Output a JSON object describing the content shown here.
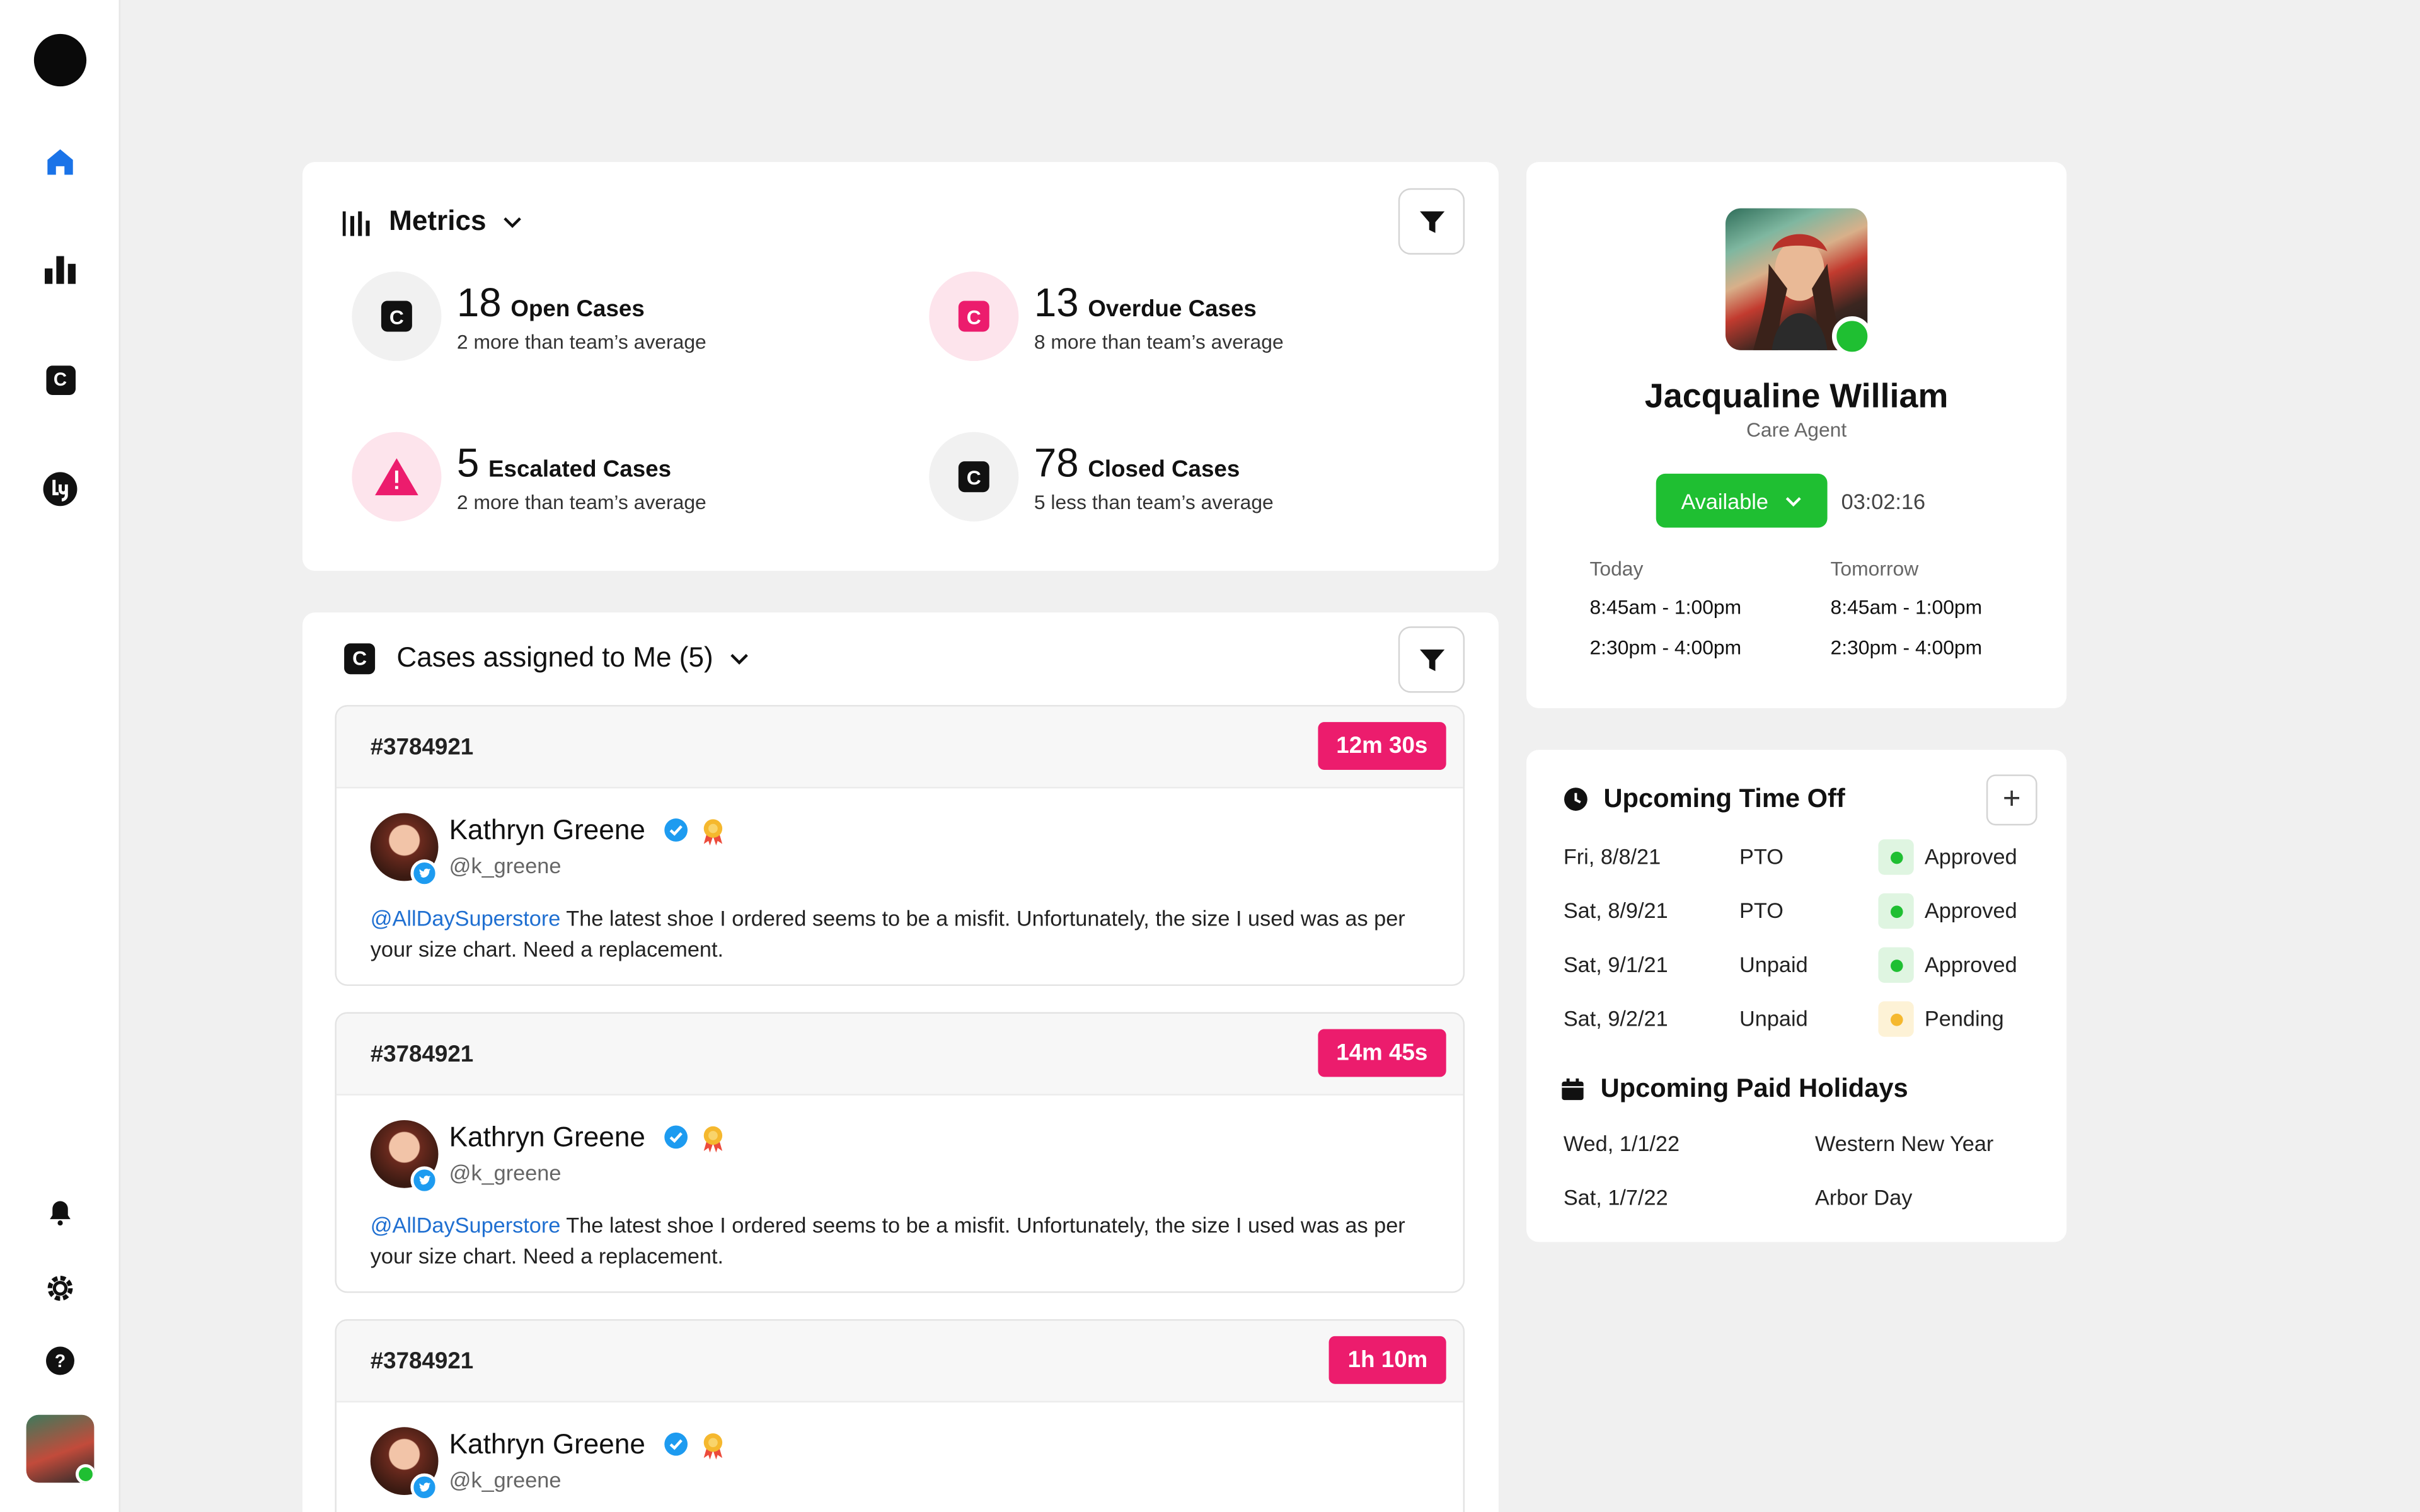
{
  "colors": {
    "accent_blue": "#1a73e8",
    "pink": "#ec1c6d",
    "green": "#1fbf32",
    "yellow": "#f5b82e"
  },
  "sidebar": {
    "items": [
      {
        "name": "home",
        "icon": "home-icon"
      },
      {
        "name": "reports",
        "icon": "bar-chart-icon"
      },
      {
        "name": "cases",
        "icon": "case-icon"
      },
      {
        "name": "brand",
        "icon": "brand-icon"
      },
      {
        "name": "notifications",
        "icon": "bell-icon"
      },
      {
        "name": "settings",
        "icon": "gear-icon"
      },
      {
        "name": "help",
        "icon": "help-icon"
      }
    ]
  },
  "metrics": {
    "title": "Metrics",
    "items": [
      {
        "value": "18",
        "label": "Open Cases",
        "sub": "2 more than team’s average"
      },
      {
        "value": "13",
        "label": "Overdue Cases",
        "sub": "8 more than team’s average"
      },
      {
        "value": "5",
        "label": "Escalated Cases",
        "sub": "2 more than team’s average"
      },
      {
        "value": "78",
        "label": "Closed Cases",
        "sub": "5 less than team’s average"
      }
    ]
  },
  "cases": {
    "title": "Cases assigned to Me (5)",
    "items": [
      {
        "id": "#3784921",
        "timer": "12m 30s",
        "author": "Kathryn Greene",
        "handle": "@k_greene",
        "mention": "@AllDaySuperstore",
        "text": " The latest shoe I ordered seems to be a misfit. Unfortunately, the size I used was as per your size chart. Need a replacement."
      },
      {
        "id": "#3784921",
        "timer": "14m 45s",
        "author": "Kathryn Greene",
        "handle": "@k_greene",
        "mention": "@AllDaySuperstore",
        "text": " The latest shoe I ordered seems to be a misfit. Unfortunately, the size I used was as per your size chart. Need a replacement."
      },
      {
        "id": "#3784921",
        "timer": "1h 10m",
        "author": "Kathryn Greene",
        "handle": "@k_greene",
        "mention": "",
        "text": ""
      }
    ]
  },
  "profile": {
    "name": "Jacqualine William",
    "role": "Care Agent",
    "status": "Available",
    "timer": "03:02:16",
    "today_label": "Today",
    "tomorrow_label": "Tomorrow",
    "today": [
      "8:45am - 1:00pm",
      "2:30pm - 4:00pm"
    ],
    "tomorrow": [
      "8:45am - 1:00pm",
      "2:30pm - 4:00pm"
    ]
  },
  "time_off": {
    "title": "Upcoming Time Off",
    "rows": [
      {
        "date": "Fri, 8/8/21",
        "type": "PTO",
        "status": "Approved"
      },
      {
        "date": "Sat, 8/9/21",
        "type": "PTO",
        "status": "Approved"
      },
      {
        "date": "Sat, 9/1/21",
        "type": "Unpaid",
        "status": "Approved"
      },
      {
        "date": "Sat, 9/2/21",
        "type": "Unpaid",
        "status": "Pending"
      }
    ]
  },
  "holidays": {
    "title": "Upcoming Paid Holidays",
    "rows": [
      {
        "date": "Wed, 1/1/22",
        "name": "Western New Year"
      },
      {
        "date": "Sat, 1/7/22",
        "name": "Arbor Day"
      }
    ]
  }
}
